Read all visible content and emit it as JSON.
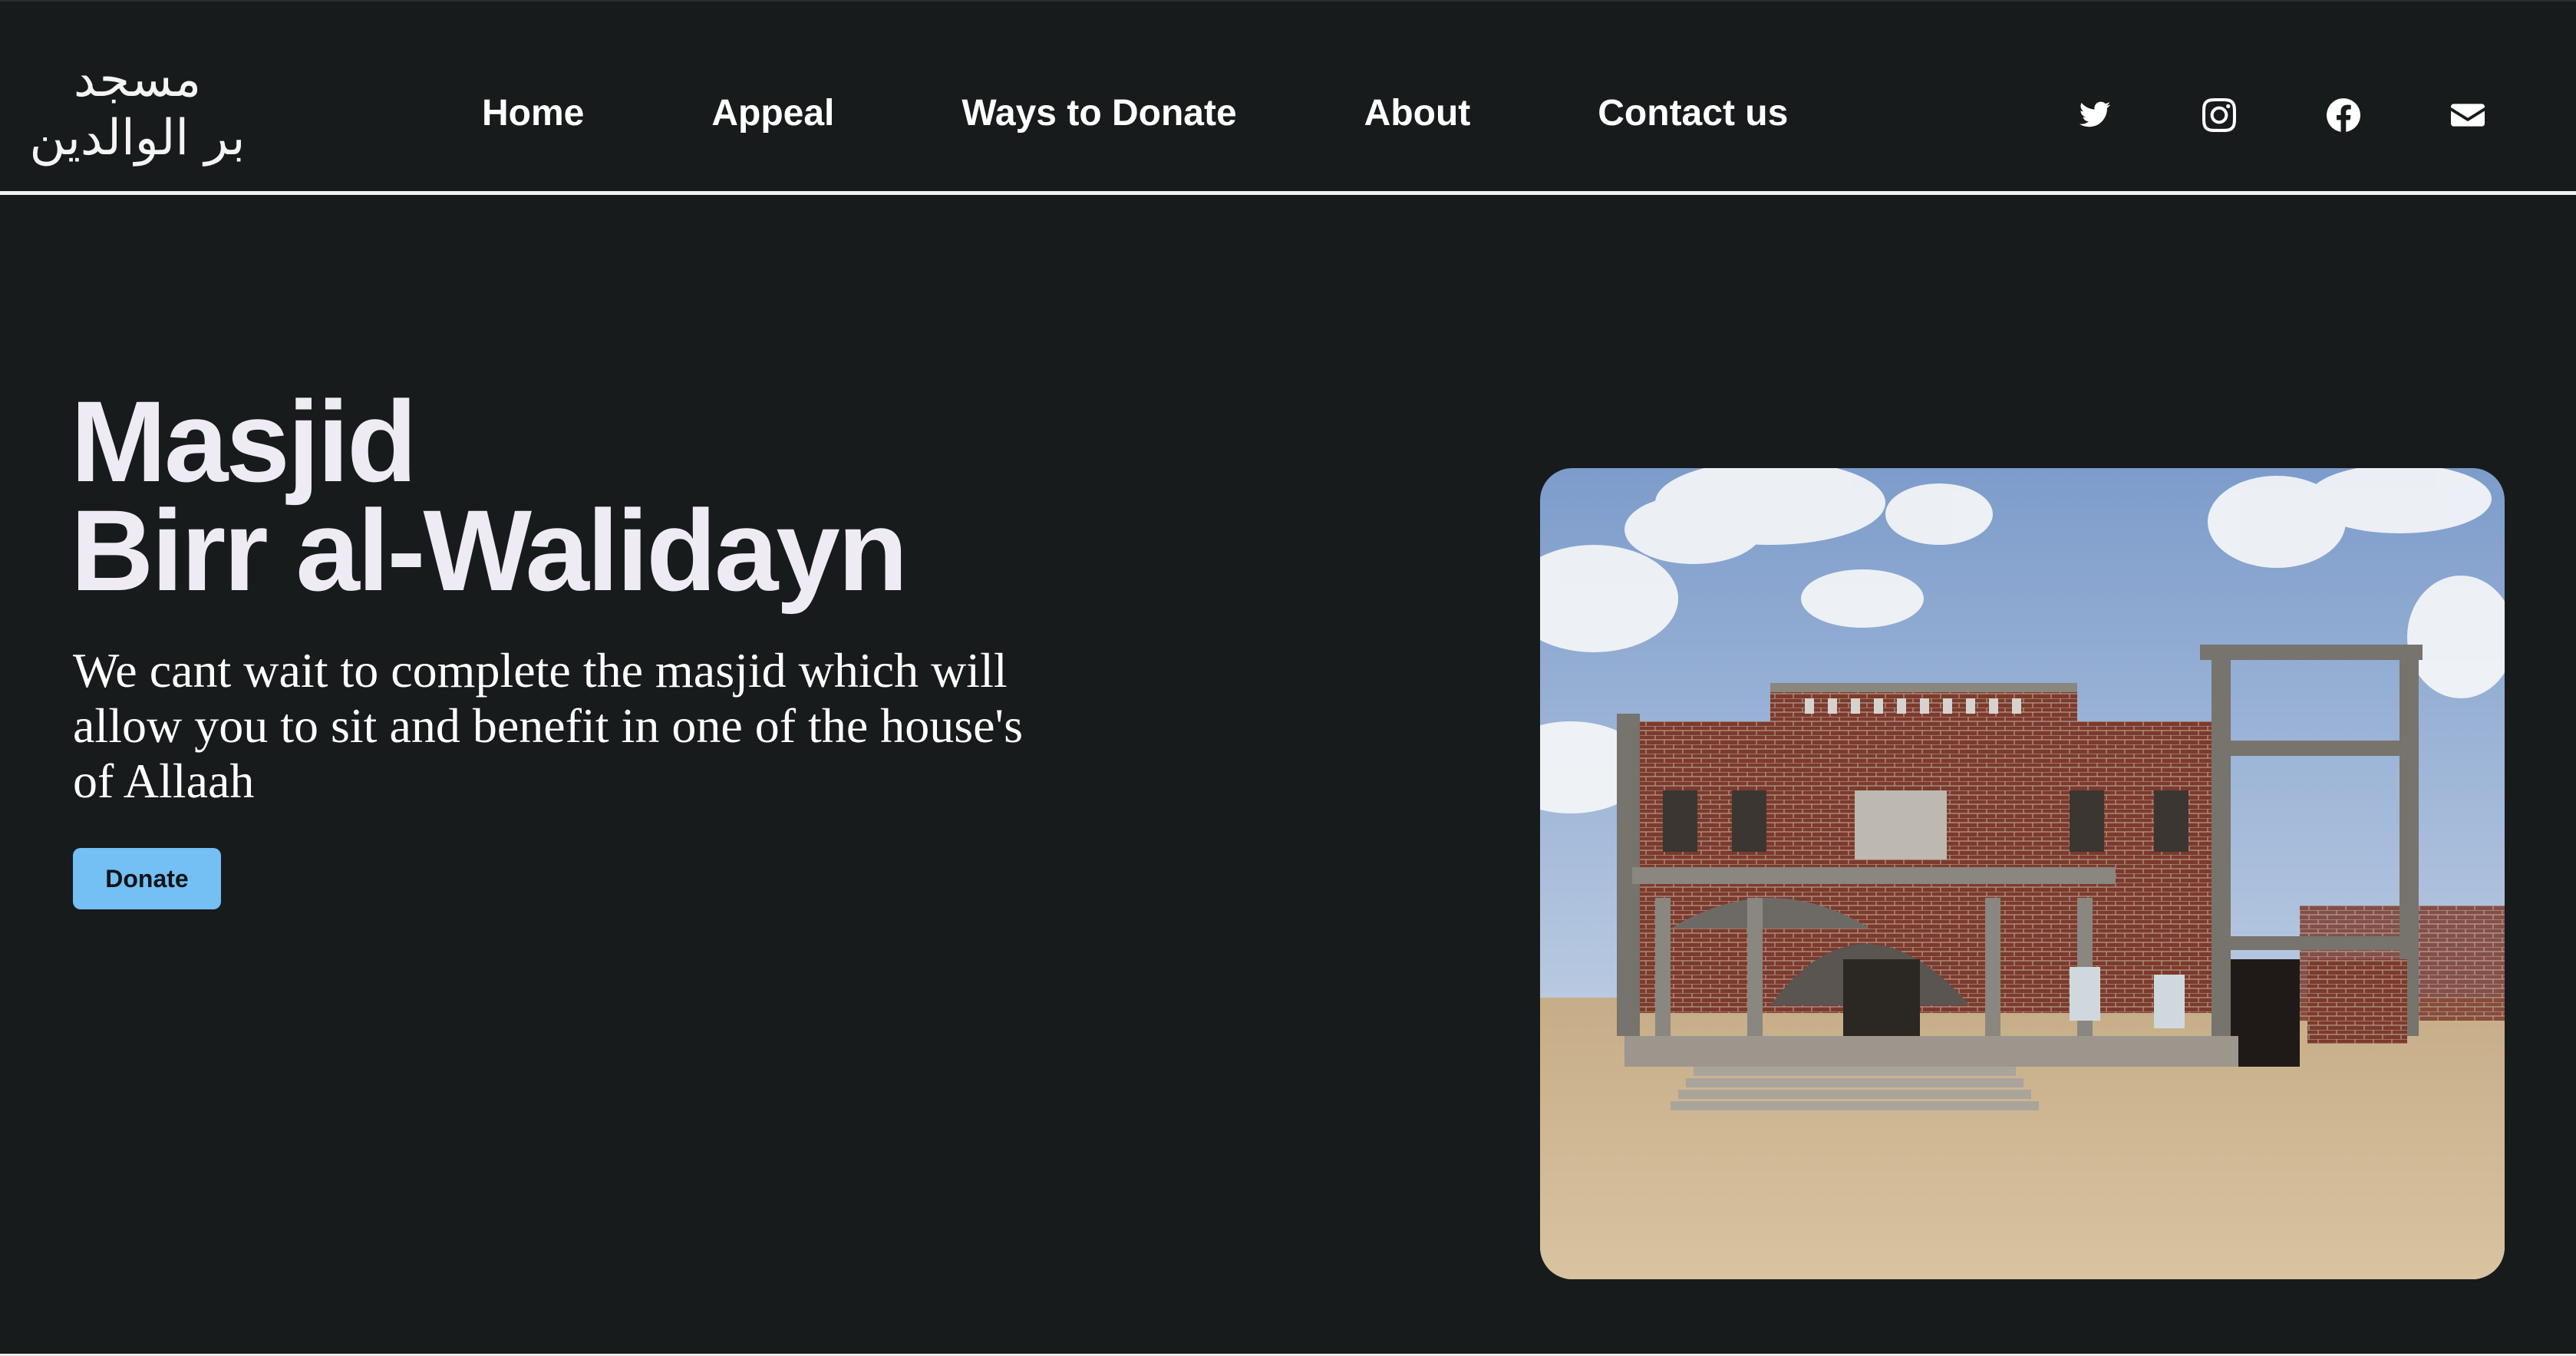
{
  "logo": {
    "line1": "مسجد",
    "line2": "بر الوالدين"
  },
  "nav": {
    "items": [
      {
        "label": "Home"
      },
      {
        "label": "Appeal"
      },
      {
        "label": "Ways to Donate"
      },
      {
        "label": "About"
      },
      {
        "label": "Contact us"
      }
    ]
  },
  "social": {
    "icons": [
      "twitter-icon",
      "instagram-icon",
      "facebook-icon",
      "email-icon"
    ]
  },
  "hero": {
    "title_line1": "Masjid",
    "title_line2": "Birr al-Walidayn",
    "text": "We cant wait to complete the masjid which will allow you to sit and benefit in one of the house's of Allaah",
    "donate_label": "Donate"
  },
  "colors": {
    "background": "#181b1c",
    "accent": "#74bff4",
    "title": "#efebf4"
  }
}
